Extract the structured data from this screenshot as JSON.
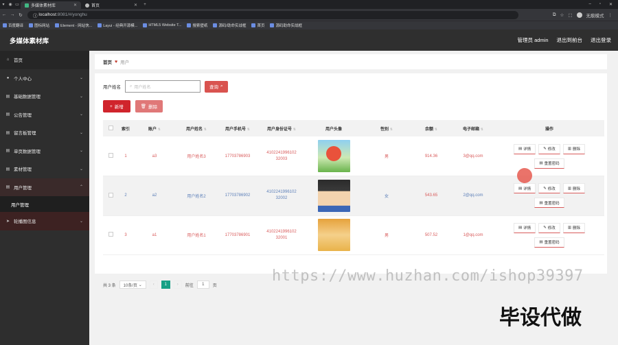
{
  "browser": {
    "tabs": [
      {
        "title": "多媒体素材库",
        "active": true
      },
      {
        "title": "首页",
        "active": false
      }
    ],
    "new_tab": "+",
    "url_host": "localhost",
    "url_rest": ":8081/#/yonghu",
    "profile_label": "无痕模式",
    "bookmarks": [
      "百度翻译",
      "图标网站",
      "Element - 网站快...",
      "Layui - 经典开源模...",
      "HTML5 Website T...",
      "搜索壁纸",
      "源码/助命实战框",
      "首页",
      "源码助命实战框"
    ]
  },
  "header": {
    "title": "多媒体素材库",
    "admin_label": "管理员 admin",
    "exit_front": "退出到前台",
    "logout": "退出登录"
  },
  "sidebar": {
    "items": [
      {
        "label": "首页",
        "icon": "home-icon"
      },
      {
        "label": "个人中心",
        "icon": "user-icon",
        "arrow": "⌄"
      },
      {
        "label": "基础数据管理",
        "icon": "grid-icon",
        "arrow": "⌄"
      },
      {
        "label": "公告管理",
        "icon": "grid-icon",
        "arrow": "⌄"
      },
      {
        "label": "留言板管理",
        "icon": "grid-icon",
        "arrow": "⌄"
      },
      {
        "label": "单页数据管理",
        "icon": "grid-icon",
        "arrow": "⌄"
      },
      {
        "label": "素材管理",
        "icon": "grid-icon",
        "arrow": "⌄"
      },
      {
        "label": "用户管理",
        "icon": "grid-icon",
        "arrow": "⌃"
      }
    ],
    "submenu": "用户管理",
    "last_item": {
      "label": "轮播图信息",
      "icon": "send-icon",
      "arrow": "⌄"
    }
  },
  "breadcrumb": {
    "home": "首页",
    "current": "用户"
  },
  "search": {
    "label": "用户姓名",
    "placeholder": "用户姓名",
    "button": "查询"
  },
  "actions": {
    "add": "新增",
    "delete": "删除"
  },
  "table": {
    "headers": [
      "索引",
      "账户",
      "用户姓名",
      "用户手机号",
      "用户身份证号",
      "用户头像",
      "性别",
      "余额",
      "电子邮箱",
      "操作"
    ],
    "rows": [
      {
        "index": "1",
        "account": "a3",
        "name": "用户姓名3",
        "phone": "17703786903",
        "idcard1": "4102241996102",
        "idcard2": "32003",
        "gender": "男",
        "balance": "914.36",
        "email": "3@qq.com"
      },
      {
        "index": "2",
        "account": "a2",
        "name": "用户姓名2",
        "phone": "17703786902",
        "idcard1": "4102241996102",
        "idcard2": "32002",
        "gender": "女",
        "balance": "543.65",
        "email": "2@qq.com"
      },
      {
        "index": "3",
        "account": "a1",
        "name": "用户姓名1",
        "phone": "17703786901",
        "idcard1": "4102241996102",
        "idcard2": "32001",
        "gender": "男",
        "balance": "507.52",
        "email": "1@qq.com"
      }
    ],
    "op_labels": {
      "detail": "详情",
      "edit": "修改",
      "delete": "删除",
      "reset": "重置密码"
    }
  },
  "pagination": {
    "total": "共 3 条",
    "page_size": "10条/页",
    "current": "1",
    "goto_prefix": "前往",
    "goto_value": "1",
    "goto_suffix": "页"
  },
  "overlay": {
    "watermark": "https://www.huzhan.com/ishop39397",
    "caption": "毕设代做"
  },
  "colors": {
    "accent": "#d0242c",
    "sidebar": "#2e2e2e",
    "header": "#2f2f2f",
    "pager_active": "#16a085"
  }
}
